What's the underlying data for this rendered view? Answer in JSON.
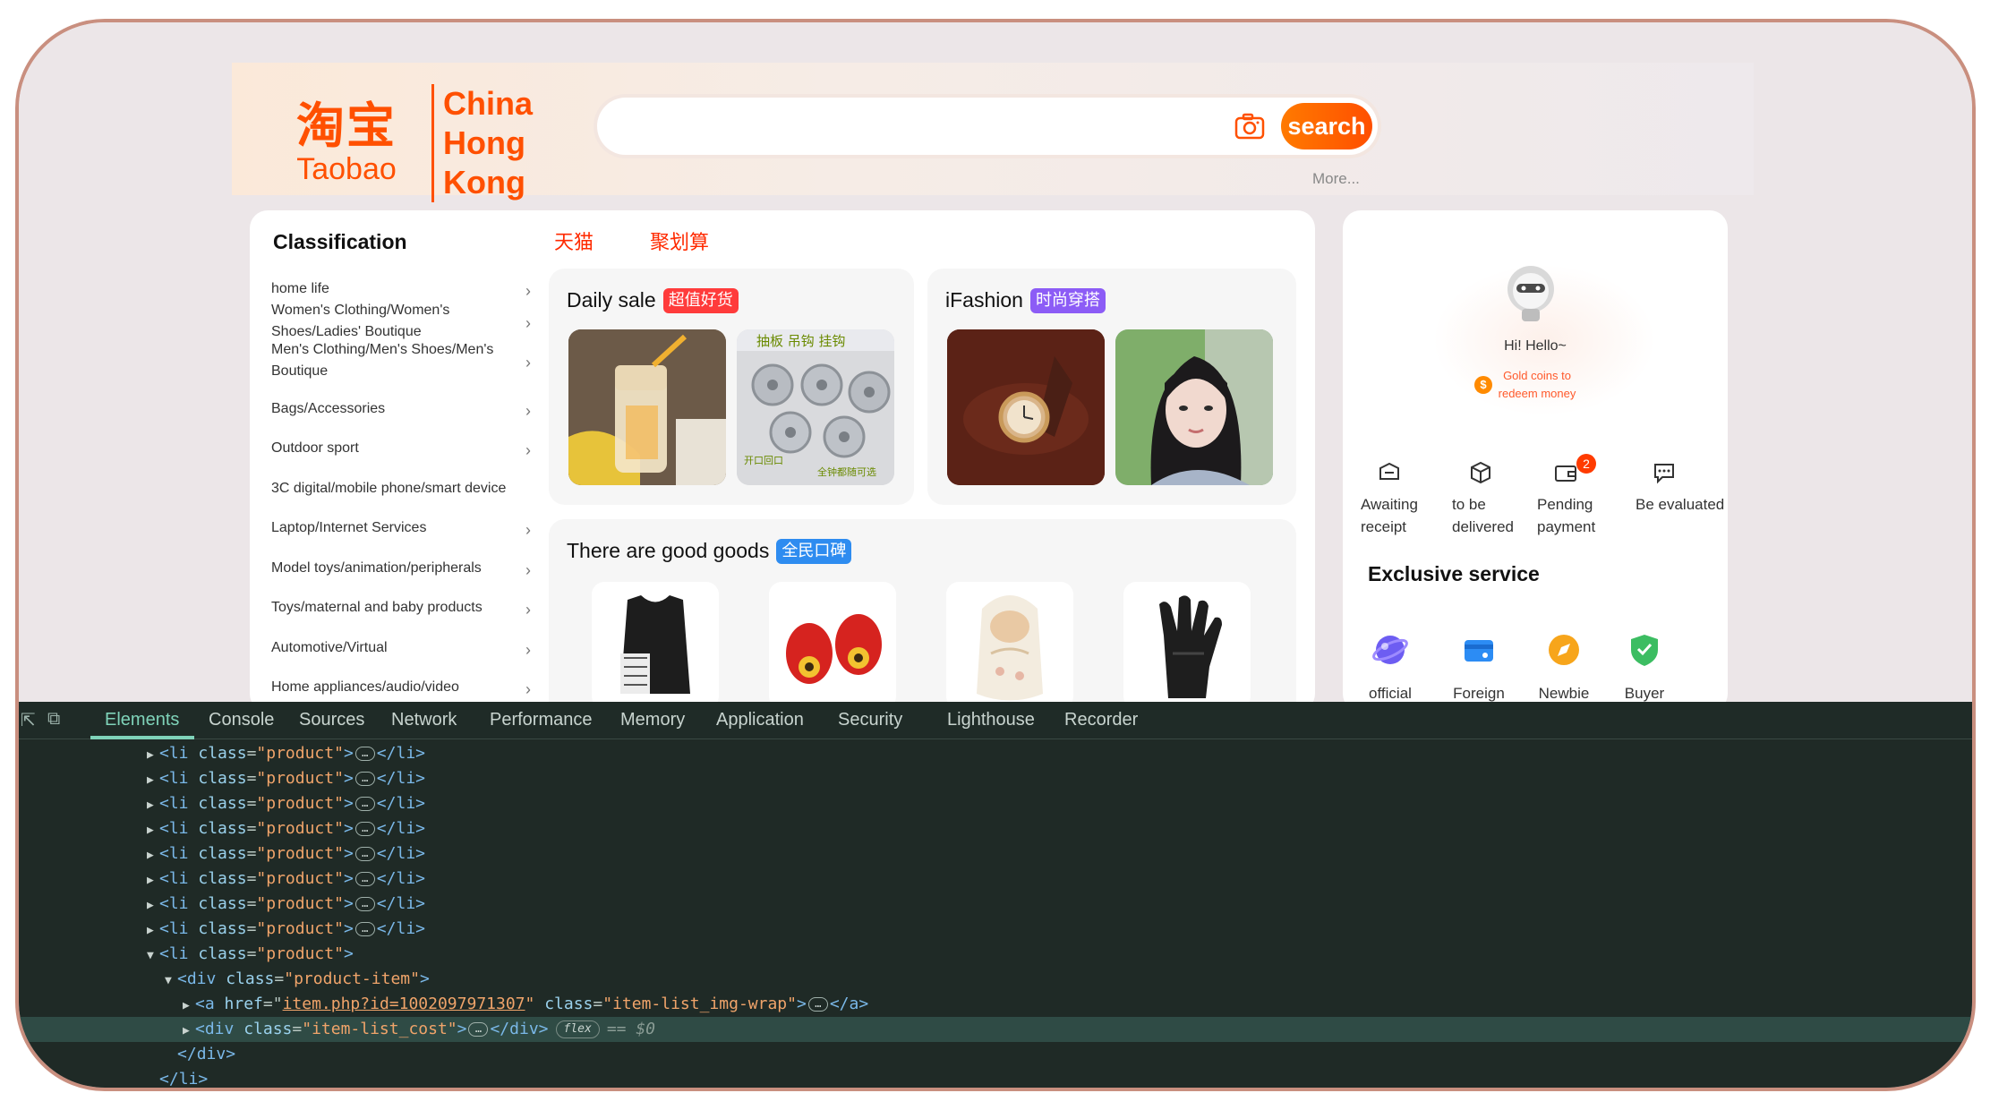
{
  "header": {
    "logo_cn": "淘宝",
    "logo_en": "Taobao",
    "region_lines": [
      "China",
      "Hong",
      "Kong"
    ],
    "search_button": "search",
    "more_link": "More..."
  },
  "classification": {
    "title": "Classification",
    "items": [
      "home life",
      "Women's Clothing/Women's Shoes/Ladies' Boutique",
      "Men's Clothing/Men's Shoes/Men's Boutique",
      "Bags/Accessories",
      "Outdoor sport",
      "3C digital/mobile phone/smart device",
      "Laptop/Internet Services",
      "Model toys/animation/peripherals",
      "Toys/maternal and baby products",
      "Automotive/Virtual",
      "Home appliances/audio/video"
    ]
  },
  "top_links": {
    "tmall": "天猫",
    "juhuasuan": "聚划算"
  },
  "tiles": {
    "daily_sale": {
      "title": "Daily sale",
      "tag": "超值好货"
    },
    "ifashion": {
      "title": "iFashion",
      "tag": "时尚穿搭"
    },
    "good_goods": {
      "title": "There are good goods",
      "tag": "全民口碑"
    },
    "thumb_text": {
      "top": "抽板 吊钩 挂钩",
      "left": "开口回口",
      "right": "全钟都随可选"
    }
  },
  "side": {
    "hello": "Hi! Hello~",
    "coins": "Gold coins to redeem money",
    "coin_symbol": "$",
    "orders": [
      {
        "label": "Awaiting receipt",
        "icon": "receipt-icon"
      },
      {
        "label": "to be delivered",
        "icon": "box-icon"
      },
      {
        "label": "Pending payment",
        "icon": "wallet-icon",
        "badge": "2"
      },
      {
        "label": "Be evaluated",
        "icon": "comment-icon"
      }
    ],
    "exclusive_title": "Exclusive service",
    "services": [
      {
        "label": "official",
        "icon": "globe-icon"
      },
      {
        "label": "Foreign",
        "icon": "card-icon"
      },
      {
        "label": "Newbie",
        "icon": "compass-icon"
      },
      {
        "label": "Buyer",
        "icon": "shield-icon"
      }
    ]
  },
  "devtools": {
    "tabs": [
      "Elements",
      "Console",
      "Sources",
      "Network",
      "Performance",
      "Memory",
      "Application",
      "Security",
      "Lighthouse",
      "Recorder"
    ],
    "active_tab": "Elements",
    "code": {
      "li_tag": "li",
      "class_attr": "class",
      "product_val": "\"product\"",
      "div_tag": "div",
      "product_item_val": "\"product-item\"",
      "a_tag": "a",
      "href_attr": "href",
      "href_val": "item.php?id=1002097971307",
      "img_wrap_val": "\"item-list_img-wrap\"",
      "cost_val": "\"item-list_cost\"",
      "flex_badge": "flex",
      "eq_text": "== $0"
    }
  },
  "colors": {
    "brand_orange": "#ff5000",
    "devtools_bg": "#1f2a26",
    "devtools_accent": "#7fd3b9",
    "frame_border": "#c98f7f"
  }
}
